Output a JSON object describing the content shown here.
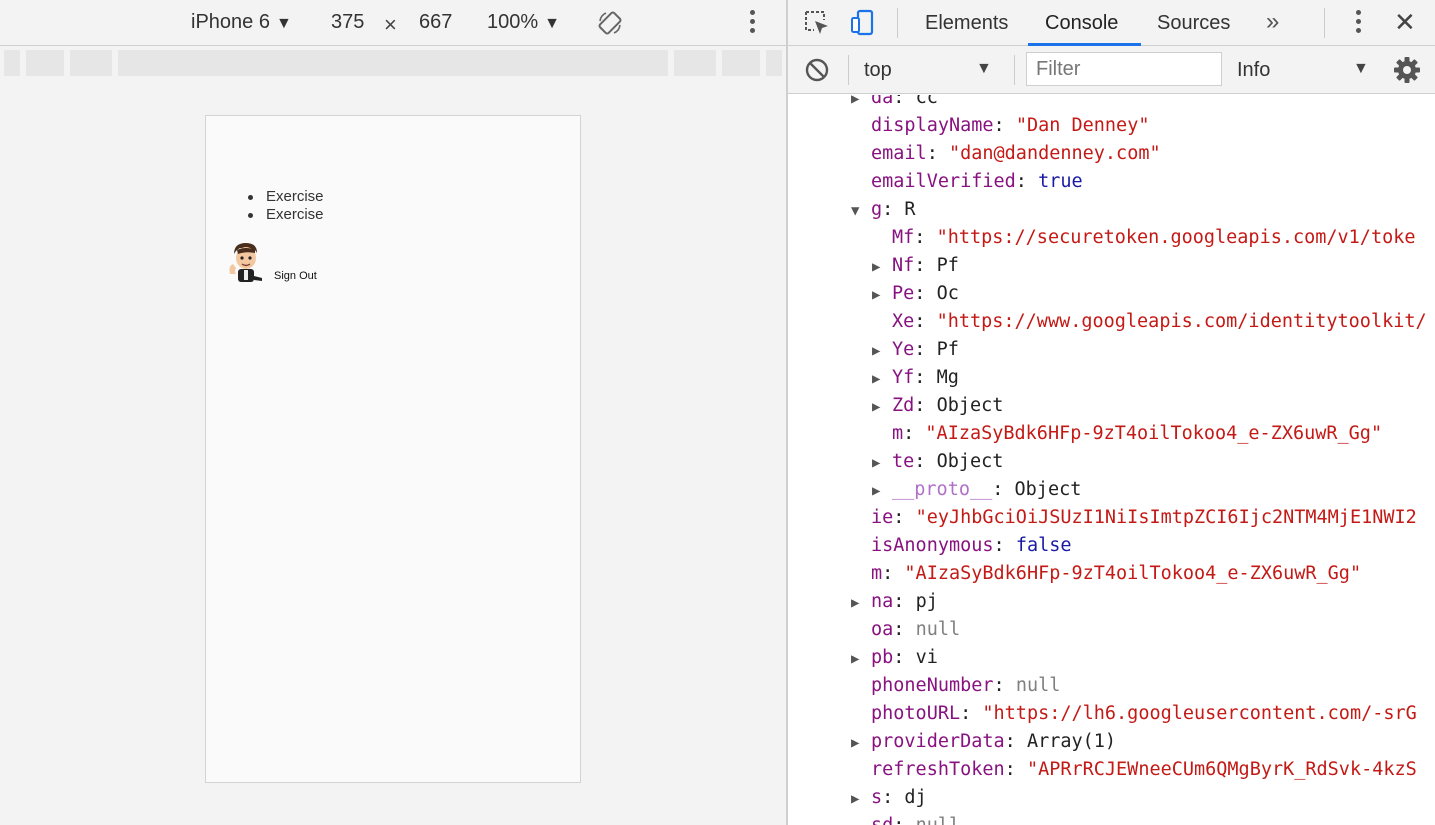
{
  "device_toolbar": {
    "device": "iPhone 6",
    "width": "375",
    "times": "×",
    "height": "667",
    "zoom": "100%"
  },
  "app": {
    "list_items": [
      "Exercise",
      "Exercise"
    ],
    "sign_out_label": "Sign Out"
  },
  "devtools": {
    "tabs": [
      "Elements",
      "Console",
      "Sources"
    ],
    "active_tab": "Console",
    "more_tabs_label": "»",
    "close_label": "✕",
    "accent_color": "#1a73e8"
  },
  "console": {
    "context": "top",
    "filter_placeholder": "Filter",
    "level": "Info",
    "lines": [
      {
        "indent": 0,
        "toggle": "▶",
        "key": "da",
        "value": "cc",
        "type": "obj"
      },
      {
        "indent": 0,
        "toggle": "",
        "key": "displayName",
        "value": "\"Dan Denney\"",
        "type": "str"
      },
      {
        "indent": 0,
        "toggle": "",
        "key": "email",
        "value": "\"dan@dandenney.com\"",
        "type": "str"
      },
      {
        "indent": 0,
        "toggle": "",
        "key": "emailVerified",
        "value": "true",
        "type": "bool"
      },
      {
        "indent": 0,
        "toggle": "▼",
        "key": "g",
        "value": "R",
        "type": "obj"
      },
      {
        "indent": 1,
        "toggle": "",
        "key": "Mf",
        "value": "\"https://securetoken.googleapis.com/v1/toke",
        "type": "str"
      },
      {
        "indent": 1,
        "toggle": "▶",
        "key": "Nf",
        "value": "Pf",
        "type": "obj"
      },
      {
        "indent": 1,
        "toggle": "▶",
        "key": "Pe",
        "value": "Oc",
        "type": "obj"
      },
      {
        "indent": 1,
        "toggle": "",
        "key": "Xe",
        "value": "\"https://www.googleapis.com/identitytoolkit/",
        "type": "str"
      },
      {
        "indent": 1,
        "toggle": "▶",
        "key": "Ye",
        "value": "Pf",
        "type": "obj"
      },
      {
        "indent": 1,
        "toggle": "▶",
        "key": "Yf",
        "value": "Mg",
        "type": "obj"
      },
      {
        "indent": 1,
        "toggle": "▶",
        "key": "Zd",
        "value": "Object",
        "type": "obj"
      },
      {
        "indent": 1,
        "toggle": "",
        "key": "m",
        "value": "\"AIzaSyBdk6HFp-9zT4oilTokoo4_e-ZX6uwR_Gg\"",
        "type": "str"
      },
      {
        "indent": 1,
        "toggle": "▶",
        "key": "te",
        "value": "Object",
        "type": "obj"
      },
      {
        "indent": 1,
        "toggle": "▶",
        "key": "__proto__",
        "value": "Object",
        "type": "obj",
        "dim": true
      },
      {
        "indent": 0,
        "toggle": "",
        "key": "ie",
        "value": "\"eyJhbGciOiJSUzI1NiIsImtpZCI6Ijc2NTM4MjE1NWI2",
        "type": "str"
      },
      {
        "indent": 0,
        "toggle": "",
        "key": "isAnonymous",
        "value": "false",
        "type": "bool"
      },
      {
        "indent": 0,
        "toggle": "",
        "key": "m",
        "value": "\"AIzaSyBdk6HFp-9zT4oilTokoo4_e-ZX6uwR_Gg\"",
        "type": "str"
      },
      {
        "indent": 0,
        "toggle": "▶",
        "key": "na",
        "value": "pj",
        "type": "obj"
      },
      {
        "indent": 0,
        "toggle": "",
        "key": "oa",
        "value": "null",
        "type": "null"
      },
      {
        "indent": 0,
        "toggle": "▶",
        "key": "pb",
        "value": "vi",
        "type": "obj"
      },
      {
        "indent": 0,
        "toggle": "",
        "key": "phoneNumber",
        "value": "null",
        "type": "null"
      },
      {
        "indent": 0,
        "toggle": "",
        "key": "photoURL",
        "value": "\"https://lh6.googleusercontent.com/-srG",
        "type": "str"
      },
      {
        "indent": 0,
        "toggle": "▶",
        "key": "providerData",
        "value": "Array(1)",
        "type": "obj"
      },
      {
        "indent": 0,
        "toggle": "",
        "key": "refreshToken",
        "value": "\"APRrRCJEWneeCUm6QMgByrK_RdSvk-4kzS",
        "type": "str"
      },
      {
        "indent": 0,
        "toggle": "▶",
        "key": "s",
        "value": "dj",
        "type": "obj"
      },
      {
        "indent": 0,
        "toggle": "",
        "key": "sd",
        "value": "null",
        "type": "null"
      }
    ]
  },
  "icons": {
    "rotate": "rotate-icon",
    "inspect": "inspect-icon",
    "device": "device-toggle-icon",
    "clear": "clear-console-icon",
    "settings": "gear-icon",
    "avatar": "avatar"
  }
}
